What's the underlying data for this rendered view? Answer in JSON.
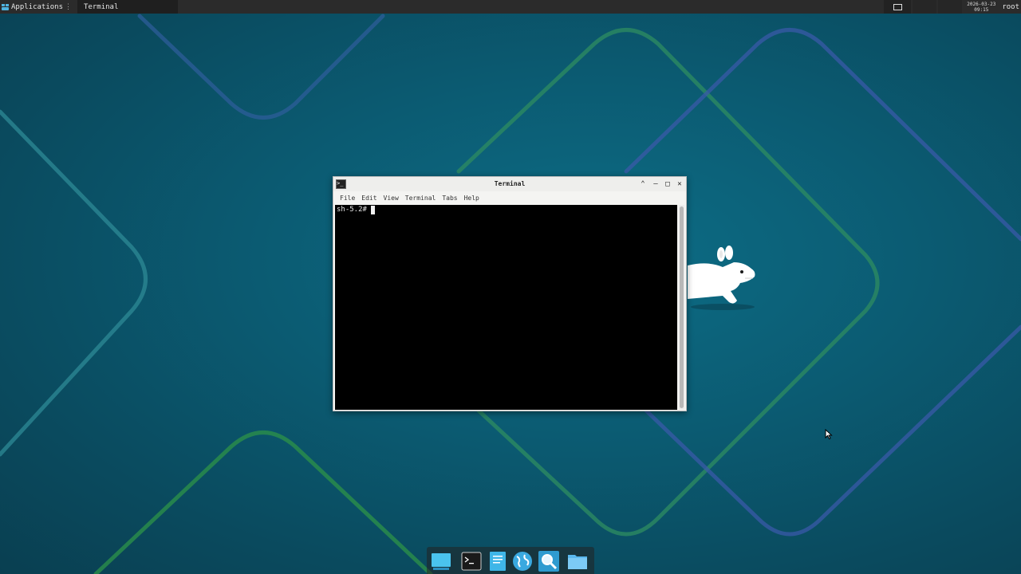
{
  "panel": {
    "applications_label": "Applications",
    "applications_sep": "⋮",
    "task_title": "Terminal",
    "clock_date": "2026-03-23",
    "clock_time": "09:15",
    "user": "root"
  },
  "window": {
    "title": "Terminal",
    "menu": [
      "File",
      "Edit",
      "View",
      "Terminal",
      "Tabs",
      "Help"
    ],
    "prompt": "sh-5.2# "
  },
  "dock": {
    "items": [
      "desktop-icon",
      "terminal-icon",
      "text-editor-icon",
      "web-browser-icon",
      "search-icon",
      "file-manager-icon"
    ]
  },
  "colors": {
    "panel": "#2b2b2b",
    "background": "#0b5b72",
    "terminal_bg": "#000000"
  }
}
